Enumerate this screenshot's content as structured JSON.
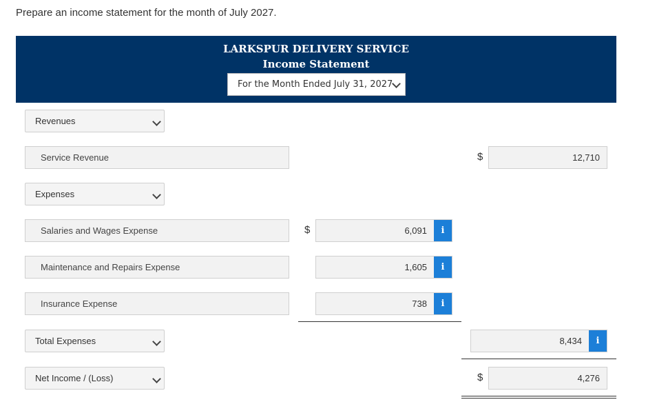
{
  "instruction": "Prepare an income statement for the month of July 2027.",
  "header": {
    "company": "LARKSPUR DELIVERY SERVICE",
    "statement": "Income Statement",
    "period": "For the Month Ended July 31, 2027"
  },
  "rows": {
    "revenues_select": "Revenues",
    "service_revenue_label": "Service Revenue",
    "service_revenue_value": "12,710",
    "expenses_select": "Expenses",
    "salaries_label": "Salaries and Wages Expense",
    "salaries_value": "6,091",
    "maintenance_label": "Maintenance and Repairs Expense",
    "maintenance_value": "1,605",
    "insurance_label": "Insurance Expense",
    "insurance_value": "738",
    "total_expenses_select": "Total Expenses",
    "total_expenses_value": "8,434",
    "net_income_select": "Net Income / (Loss)",
    "net_income_value": "4,276"
  },
  "symbols": {
    "dollar": "$",
    "info": "i"
  },
  "colors": {
    "header_bg": "#003366",
    "info_button": "#1c7fd8"
  }
}
